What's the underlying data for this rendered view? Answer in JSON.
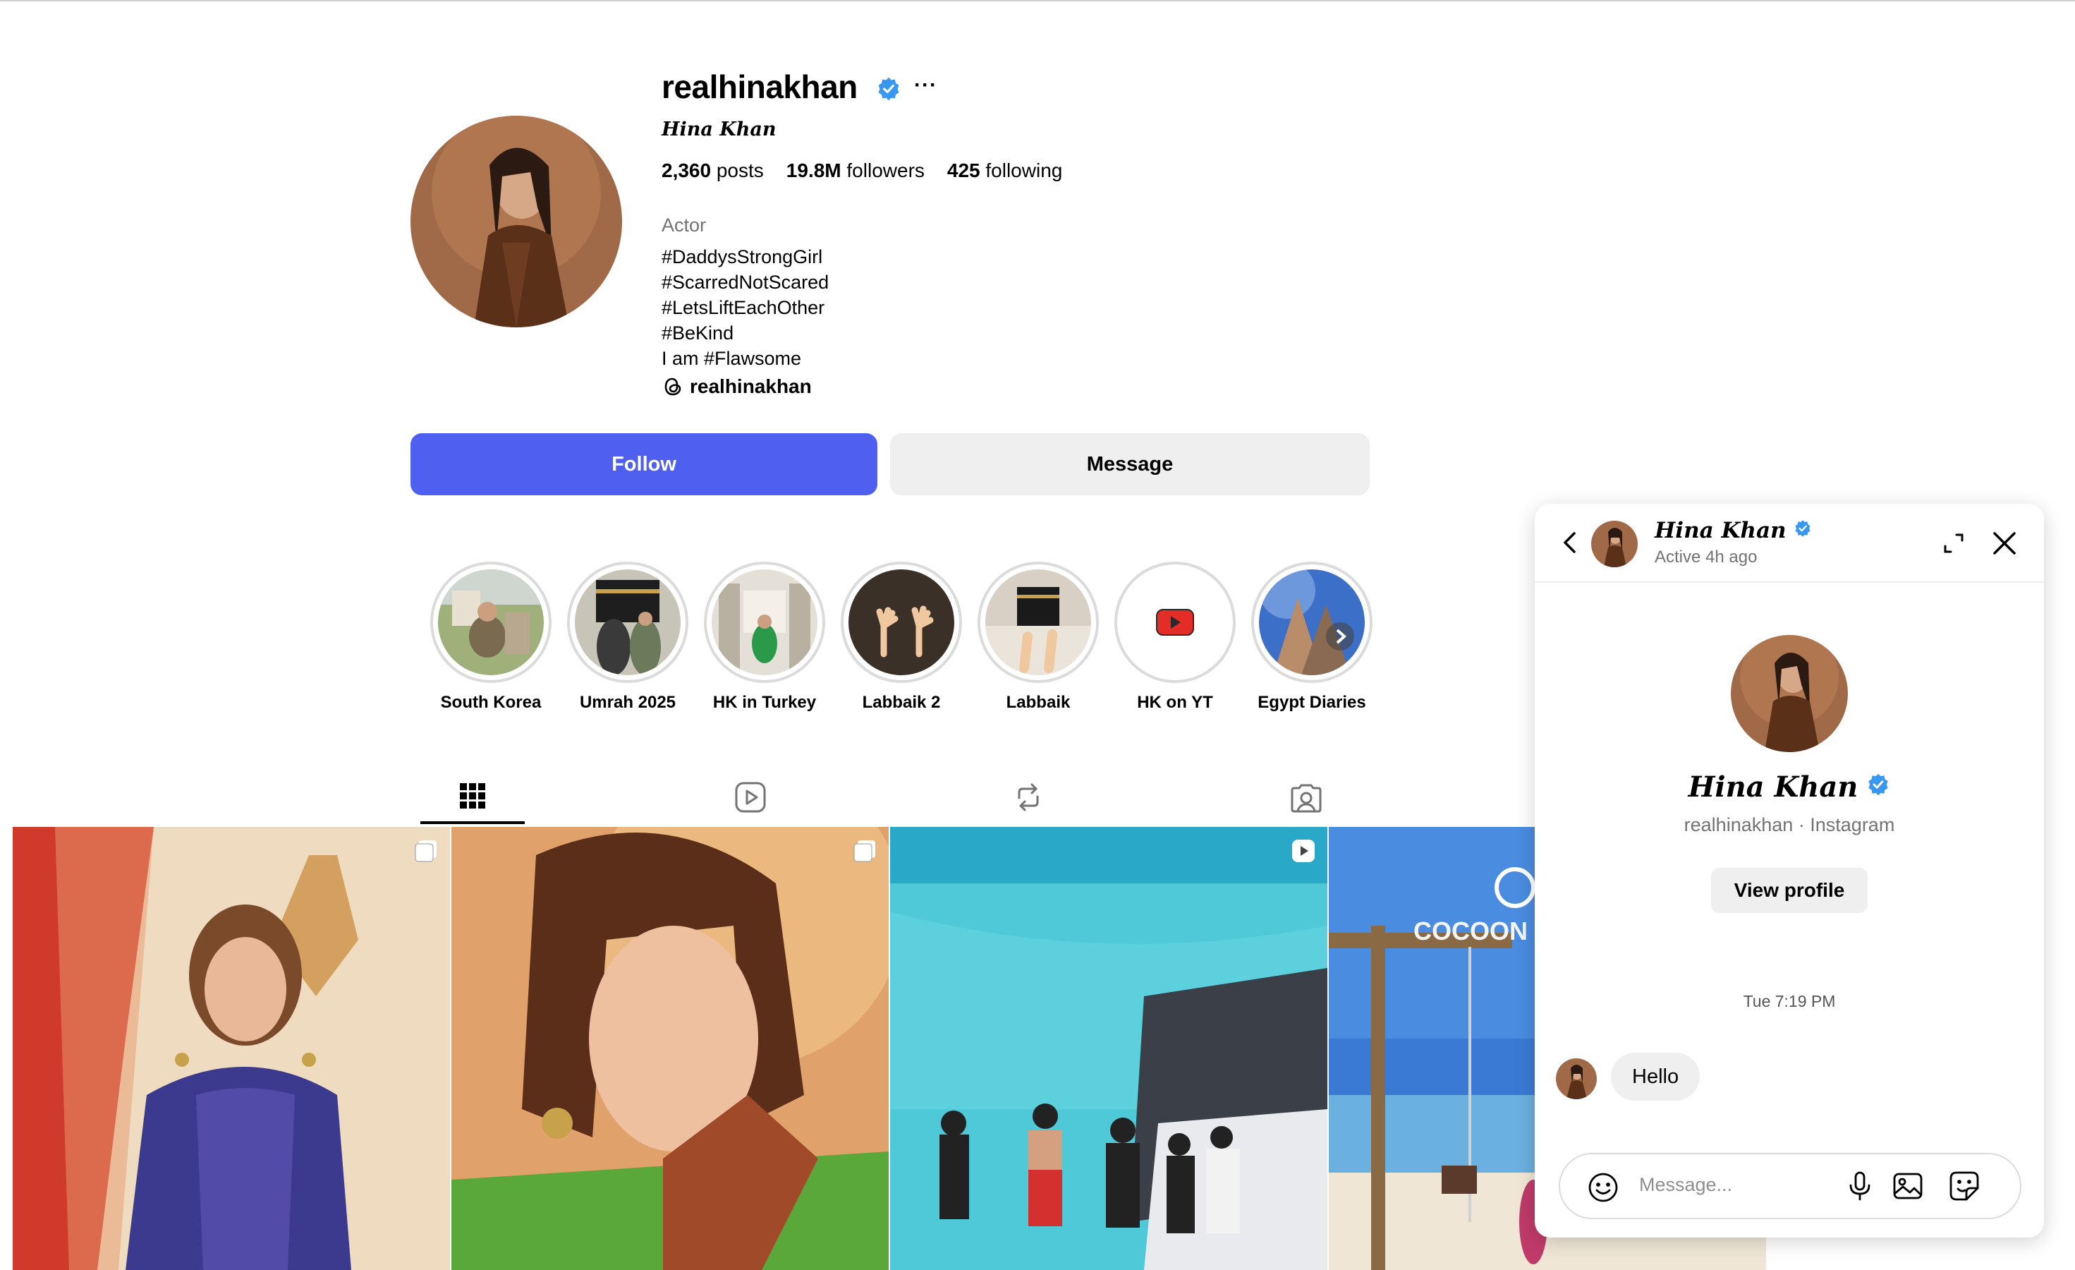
{
  "profile": {
    "username": "realhinakhan",
    "more_label": "···",
    "full_name": "Hina Khan",
    "posts_count": "2,360",
    "posts_label": "posts",
    "followers_count": "19.8M",
    "followers_label": "followers",
    "following_count": "425",
    "following_label": "following",
    "category": "Actor",
    "bio_lines": [
      "#DaddysStrongGirl",
      "#ScarredNotScared",
      "#LetsLiftEachOther",
      "#BeKind",
      "I am #Flawsome"
    ],
    "threads_handle": "realhinakhan",
    "follow_label": "Follow",
    "message_label": "Message"
  },
  "highlights": [
    {
      "label": "South Korea",
      "icon": "photo-thumbnail"
    },
    {
      "label": "Umrah 2025",
      "icon": "photo-thumbnail"
    },
    {
      "label": "HK in Turkey",
      "icon": "photo-thumbnail"
    },
    {
      "label": "Labbaik 2",
      "icon": "photo-thumbnail"
    },
    {
      "label": "Labbaik",
      "icon": "photo-thumbnail"
    },
    {
      "label": "HK on YT",
      "icon": "youtube-icon"
    },
    {
      "label": "Egypt Diaries",
      "icon": "photo-thumbnail"
    }
  ],
  "tabs": [
    {
      "name": "posts",
      "icon": "grid-icon",
      "active": true
    },
    {
      "name": "reels",
      "icon": "reels-icon",
      "active": false
    },
    {
      "name": "reposts",
      "icon": "repost-icon",
      "active": false
    },
    {
      "name": "tagged",
      "icon": "tagged-icon",
      "active": false
    }
  ],
  "grid": {
    "posts": [
      {
        "type": "carousel",
        "icon": "carousel-icon"
      },
      {
        "type": "carousel",
        "icon": "carousel-icon"
      },
      {
        "type": "reel",
        "icon": "reel-icon",
        "visible_text": ""
      },
      {
        "type": "photo",
        "visible_text": "COCOON"
      }
    ]
  },
  "chat": {
    "name": "Hina Khan",
    "status": "Active 4h ago",
    "profile_name": "Hina Khan",
    "profile_sub": "realhinakhan · Instagram",
    "view_profile_label": "View profile",
    "timestamp": "Tue 7:19 PM",
    "messages": [
      {
        "text": "Hello",
        "from": "them"
      }
    ],
    "input_placeholder": "Message..."
  },
  "colors": {
    "follow_button": "#4f5ff0",
    "verified": "#3897f0",
    "secondary_text": "#737373",
    "button_gray": "#efefef"
  }
}
